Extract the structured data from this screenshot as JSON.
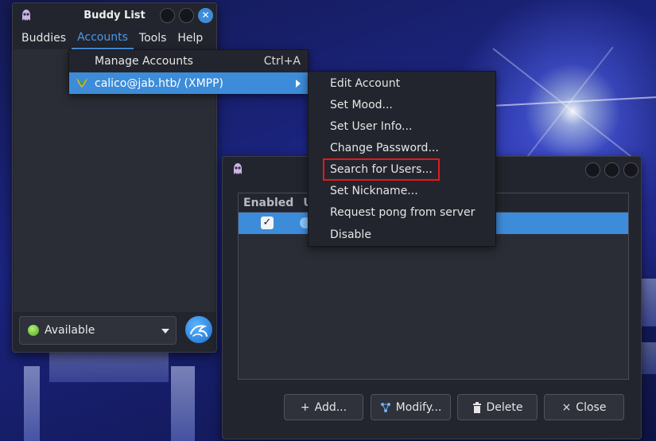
{
  "buddy_list": {
    "title": "Buddy List",
    "close_glyph": "✕",
    "menus": [
      "Buddies",
      "Accounts",
      "Tools",
      "Help"
    ],
    "status": "Available"
  },
  "accounts_menu": {
    "manage_label": "Manage Accounts",
    "manage_shortcut": "Ctrl+A",
    "account_label": "calico@jab.htb/ (XMPP)"
  },
  "account_submenu": {
    "items": [
      "Edit Account",
      "Set Mood...",
      "Set User Info...",
      "Change Password...",
      "Search for Users...",
      "Set Nickname...",
      "Request pong from server",
      "Disable"
    ]
  },
  "accounts_window": {
    "columns": [
      "Enabled",
      "U"
    ],
    "row_checked": "✓",
    "buttons": {
      "add": "Add...",
      "modify": "Modify...",
      "delete": "Delete",
      "close": "Close"
    }
  },
  "colors": {
    "accent": "#3d8cd9",
    "highlight_box": "#e81818",
    "menu_bg": "#23252e"
  },
  "icons": {
    "app": "pidgin-icon",
    "account": "xmpp-icon",
    "status": "available-status-icon",
    "avatar": "kali-avatar-icon"
  }
}
